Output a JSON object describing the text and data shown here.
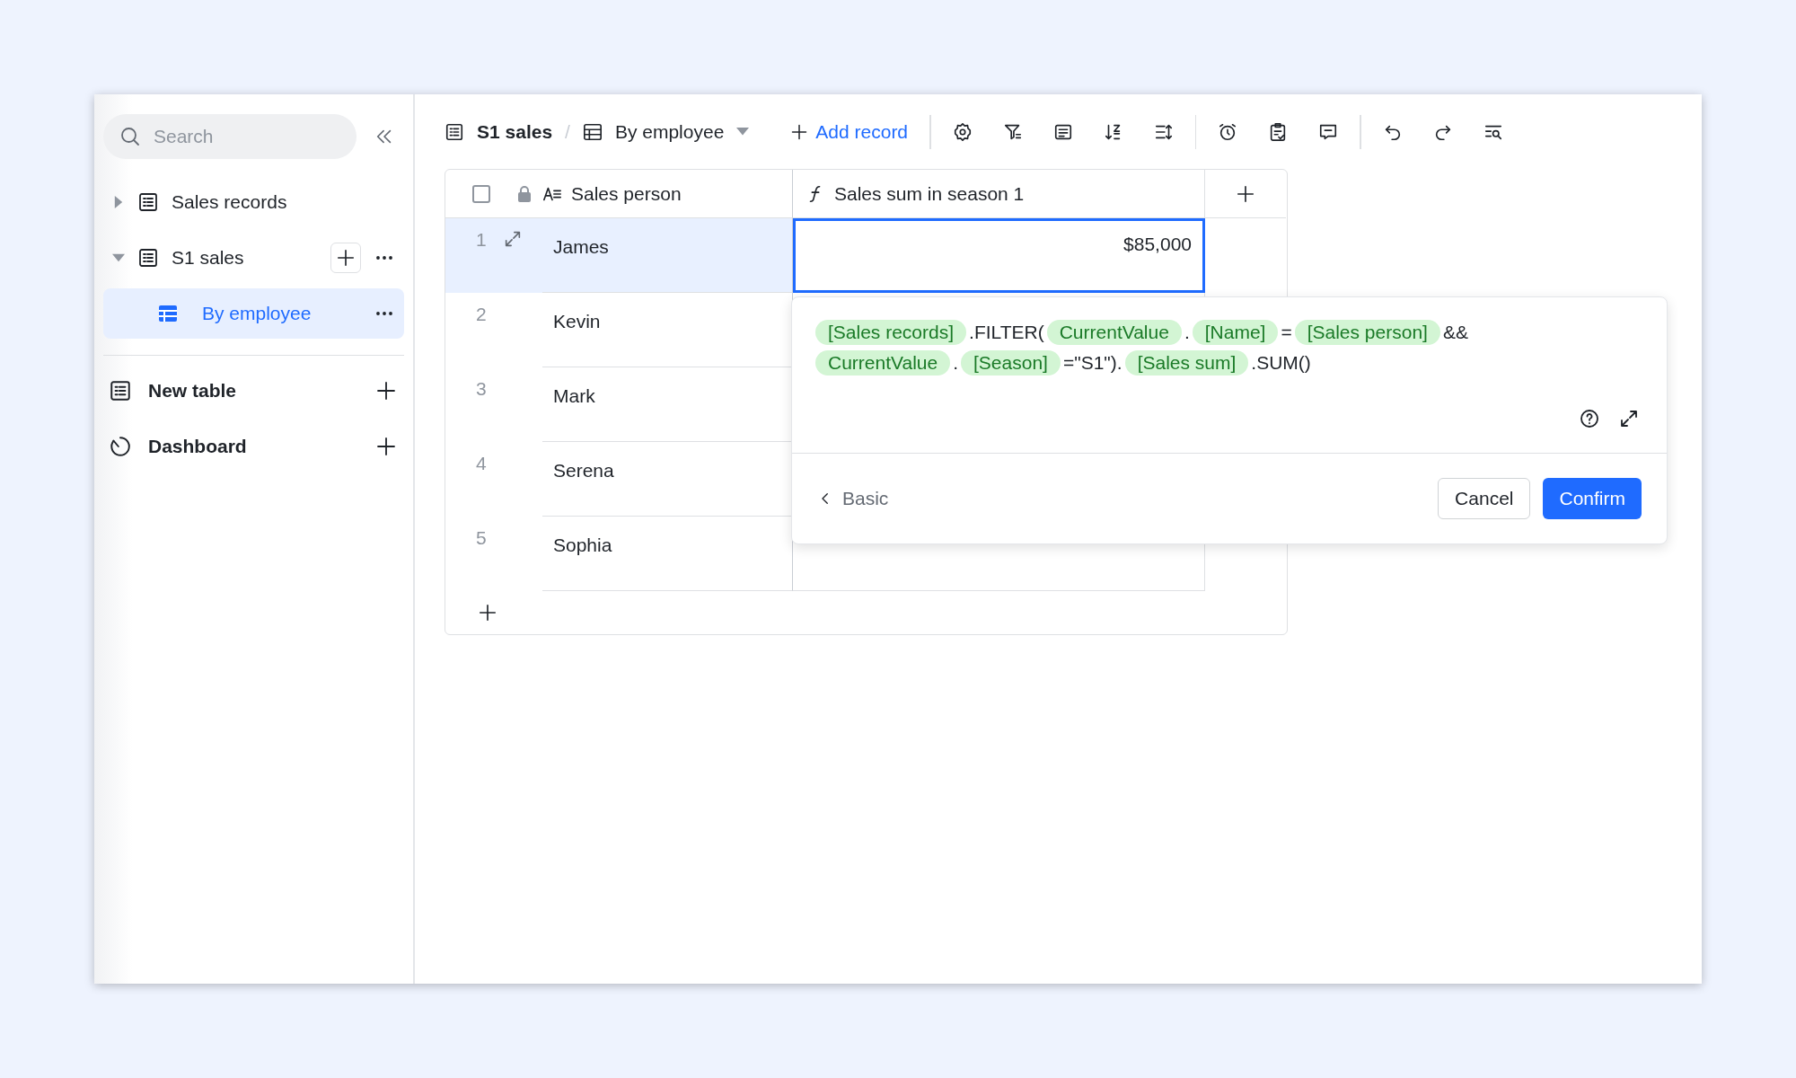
{
  "sidebar": {
    "search": {
      "placeholder": "Search"
    },
    "tree": [
      {
        "label": "Sales records",
        "expanded": false
      },
      {
        "label": "S1 sales",
        "expanded": true,
        "children": [
          {
            "label": "By employee",
            "selected": true
          }
        ]
      }
    ],
    "actions": [
      {
        "kind": "table",
        "label": "New table"
      },
      {
        "kind": "dashboard",
        "label": "Dashboard"
      }
    ]
  },
  "breadcrumb": {
    "table": "S1 sales",
    "separator": "/",
    "view": "By employee"
  },
  "add_record": "Add record",
  "table": {
    "select_all": {
      "checked": false
    },
    "columns": [
      "Sales person",
      "Sales sum in season 1"
    ],
    "rows": [
      {
        "number": "1",
        "name": "James",
        "amount": "$85,000",
        "selected": true
      },
      {
        "number": "2",
        "name": "Kevin",
        "selected": false
      },
      {
        "number": "3",
        "name": "Mark",
        "selected": false
      },
      {
        "number": "4",
        "name": "Serena",
        "selected": false
      },
      {
        "number": "5",
        "name": "Sophia",
        "selected": false
      }
    ]
  },
  "formula_editor": {
    "lines": [
      [
        {
          "kind": "field",
          "text": "[Sales records]"
        },
        {
          "kind": "text",
          "text": ".FILTER("
        },
        {
          "kind": "field",
          "text": "CurrentValue"
        },
        {
          "kind": "text",
          "text": "."
        },
        {
          "kind": "field",
          "text": "[Name]"
        },
        {
          "kind": "text",
          "text": "="
        },
        {
          "kind": "field",
          "text": "[Sales person]"
        },
        {
          "kind": "text",
          "text": "&&"
        }
      ],
      [
        {
          "kind": "field",
          "text": "CurrentValue"
        },
        {
          "kind": "text",
          "text": "."
        },
        {
          "kind": "field",
          "text": "[Season]"
        },
        {
          "kind": "text",
          "text": "=\"S1\")."
        },
        {
          "kind": "field",
          "text": "[Sales sum]"
        },
        {
          "kind": "text",
          "text": ".SUM()"
        }
      ]
    ],
    "back": "Basic",
    "cancel": "Cancel",
    "confirm": "Confirm"
  }
}
